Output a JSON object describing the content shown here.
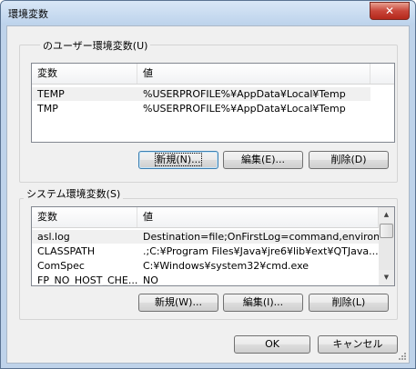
{
  "window": {
    "title": "環境変数",
    "close_glyph": "✕"
  },
  "user_vars": {
    "group_label": "のユーザー環境変数(U)",
    "columns": [
      "変数",
      "値"
    ],
    "rows": [
      {
        "name": "TEMP",
        "value": "%USERPROFILE%¥AppData¥Local¥Temp"
      },
      {
        "name": "TMP",
        "value": "%USERPROFILE%¥AppData¥Local¥Temp"
      }
    ],
    "buttons": {
      "new": "新規(N)...",
      "edit": "編集(E)...",
      "delete": "削除(D)"
    }
  },
  "system_vars": {
    "group_label": "システム環境変数(S)",
    "columns": [
      "変数",
      "値"
    ],
    "rows": [
      {
        "name": "asl.log",
        "value": "Destination=file;OnFirstLog=command,environ..."
      },
      {
        "name": "CLASSPATH",
        "value": ".;C:¥Program Files¥Java¥jre6¥lib¥ext¥QTJava..."
      },
      {
        "name": "ComSpec",
        "value": "C:¥Windows¥system32¥cmd.exe"
      },
      {
        "name": "FP_NO_HOST_CHE...",
        "value": "NO"
      }
    ],
    "scrollbar": {
      "up": "▲",
      "down": "▼"
    },
    "buttons": {
      "new": "新規(W)...",
      "edit": "編集(I)...",
      "delete": "削除(L)"
    }
  },
  "dialog_buttons": {
    "ok": "OK",
    "cancel": "キャンセル"
  }
}
